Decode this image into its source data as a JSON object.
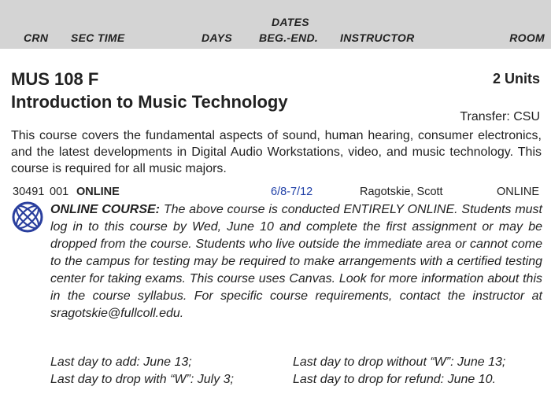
{
  "header": {
    "crn": "CRN",
    "sec_time": "SEC TIME",
    "days": "DAYS",
    "dates_top": "DATES",
    "dates_bottom": "BEG.-END.",
    "instructor": "INSTRUCTOR",
    "room": "ROOM"
  },
  "course": {
    "code": "MUS 108 F",
    "units": "2 Units",
    "title": "Introduction to Music Technology",
    "transfer": "Transfer: CSU",
    "description": "This course covers the fundamental aspects of sound, human hearing, consumer electronics, and the latest developments in Digital Audio Workstations, video, and music technology. This course is required for all music majors."
  },
  "section": {
    "crn": "30491",
    "sec": "001",
    "mode": "ONLINE",
    "dates": "6/8-7/12",
    "instructor": "Ragotskie, Scott",
    "room": "ONLINE"
  },
  "note": {
    "icon": "globe-icon",
    "heading": "ONLINE COURSE:",
    "body": "The above course is conducted ENTIRELY ONLINE. Students must log in to this course by Wed, June 10 and complete the first assignment or may be dropped from the course. Students who live outside the immediate area or cannot come to the campus for testing may be required to make arrangements with a certified testing center for taking exams. This course uses Canvas. Look for more information about this in the course syllabus. For specific course requirements, contact the instructor at sragotskie@fullcoll.edu."
  },
  "deadlines": {
    "add": "Last day to add: June 13;",
    "drop_no_w": "Last day to drop without “W”: June 13;",
    "drop_with_w": "Last day to drop with “W”: July 3;",
    "refund": "Last day to drop for refund: June 10."
  },
  "colors": {
    "header_bg": "#d4d4d4",
    "link_blue": "#1f3fa6",
    "icon_blue": "#2a3f9e"
  }
}
